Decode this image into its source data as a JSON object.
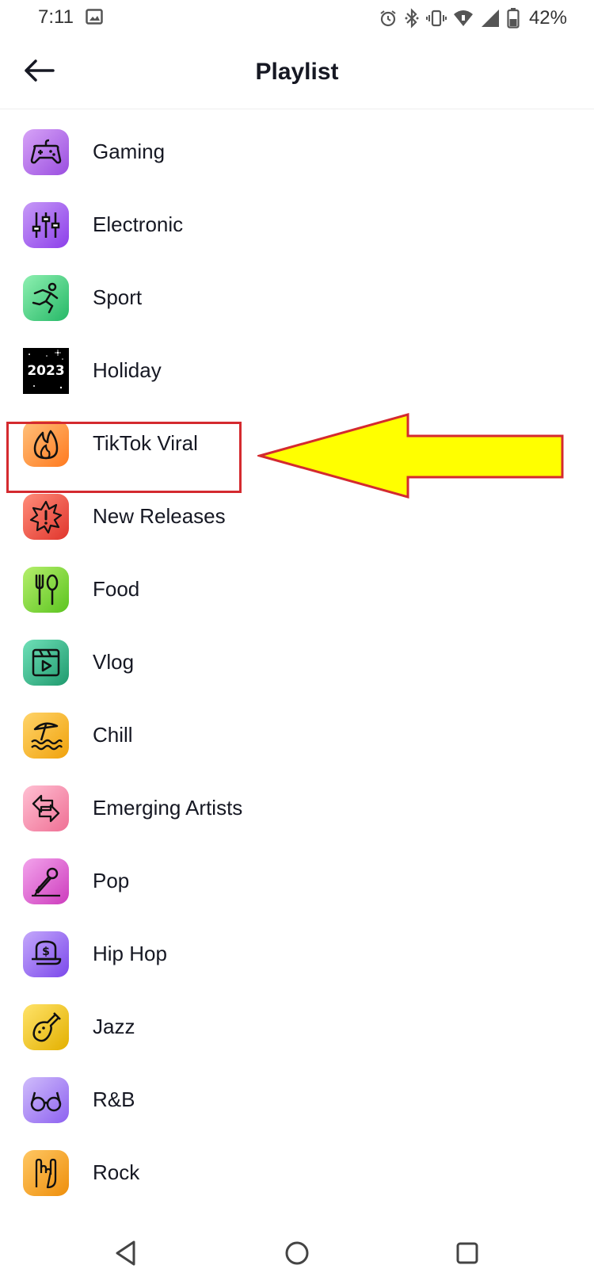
{
  "status_bar": {
    "time": "7:11",
    "battery_percent": "42%",
    "icons": [
      "gallery-icon",
      "alarm-icon",
      "bluetooth-icon",
      "vibrate-icon",
      "wifi-icon",
      "signal-icon",
      "battery-icon"
    ]
  },
  "header": {
    "title": "Playlist",
    "back_icon": "arrow-left-icon"
  },
  "playlists": [
    {
      "label": "Gaming",
      "icon": "gamepad-icon",
      "color": "#b46ee8"
    },
    {
      "label": "Electronic",
      "icon": "equalizer-icon",
      "color": "#a45cf0"
    },
    {
      "label": "Sport",
      "icon": "runner-icon",
      "color": "#3ed07a"
    },
    {
      "label": "Holiday",
      "icon": "fireworks-2023-icon",
      "color": "#000000",
      "badge_text": "2023"
    },
    {
      "label": "TikTok Viral",
      "icon": "flame-icon",
      "color": "#ff8a3d"
    },
    {
      "label": "New Releases",
      "icon": "burst-icon",
      "color": "#f0524a"
    },
    {
      "label": "Food",
      "icon": "fork-spoon-icon",
      "color": "#7bd83a"
    },
    {
      "label": "Vlog",
      "icon": "video-clapper-icon",
      "color": "#2fb58a"
    },
    {
      "label": "Chill",
      "icon": "beach-umbrella-icon",
      "color": "#f7b524"
    },
    {
      "label": "Emerging Artists",
      "icon": "swap-arrows-icon",
      "color": "#f58aa8"
    },
    {
      "label": "Pop",
      "icon": "microphone-icon",
      "color": "#e25ed0"
    },
    {
      "label": "Hip Hop",
      "icon": "cap-dollar-icon",
      "color": "#9b6df2"
    },
    {
      "label": "Jazz",
      "icon": "saxophone-icon",
      "color": "#f2c314"
    },
    {
      "label": "R&B",
      "icon": "sunglasses-icon",
      "color": "#a883f5"
    },
    {
      "label": "Rock",
      "icon": "rock-hand-icon",
      "color": "#f5a623"
    }
  ],
  "annotation": {
    "highlight_color": "#d42a2f",
    "arrow_fill": "#ffff00",
    "arrow_stroke": "#d42a2f"
  },
  "nav_bar": {
    "icons": [
      "back-triangle-icon",
      "home-circle-icon",
      "recents-square-icon"
    ]
  }
}
